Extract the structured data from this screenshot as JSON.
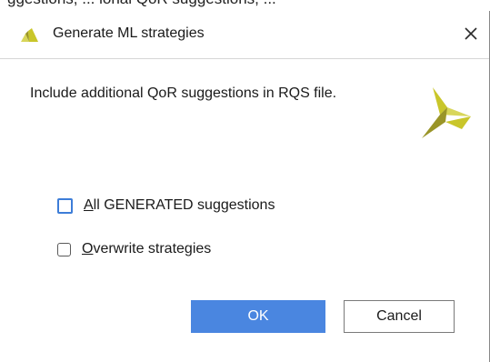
{
  "background_text": "ggestions, ... ional QoR suggestions, ...",
  "dialog": {
    "title": "Generate ML strategies",
    "title_icon": "xilinx-logo-icon",
    "close_icon": "close-icon",
    "message": "Include additional QoR suggestions in RQS file.",
    "logo": "xilinx-logo",
    "checkboxes": [
      {
        "mnemonic": "A",
        "rest": "ll GENERATED suggestions",
        "checked": false,
        "focused": true
      },
      {
        "mnemonic": "O",
        "rest": "verwrite strategies",
        "checked": false,
        "focused": false
      }
    ],
    "buttons": {
      "ok_label": "OK",
      "cancel_label": "Cancel"
    }
  },
  "colors": {
    "accent": "#4a86e0",
    "focus_border": "#3d7dd8",
    "logo_yellow": "#c9c62a",
    "logo_light": "#d8d65a",
    "logo_dark": "#9a9528"
  }
}
